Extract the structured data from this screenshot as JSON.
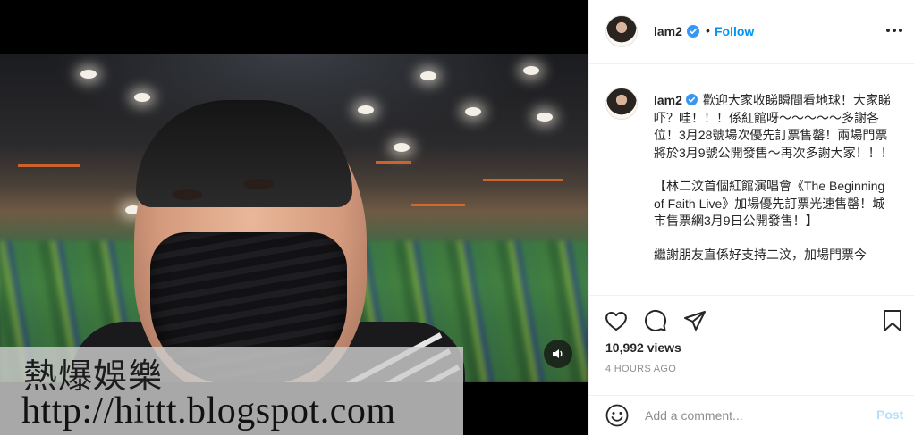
{
  "media": {
    "watermark_title": "熱爆娛樂",
    "watermark_url": "http://hittt.blogspot.com",
    "mute_icon": "speaker-icon"
  },
  "header": {
    "username": "lam2",
    "separator": "•",
    "follow_label": "Follow",
    "more_icon": "more-options-icon"
  },
  "caption": {
    "username": "lam2",
    "paragraphs": [
      "歡迎大家收睇瞬間看地球！大家睇吓？哇！！！係紅館呀～～～～～多謝各位！3月28號場次優先訂票售罄！兩場門票將於3月9號公開發售～再次多謝大家！！！",
      "【林二汶首個紅館演唱會《The Beginning of Faith Live》加場優先訂票光速售罄！城市售票網3月9日公開發售！】",
      "繼謝朋友直係好支持二汶，加場門票今"
    ]
  },
  "actions": {
    "views": "10,992 views",
    "time_ago": "4 HOURS AGO",
    "comment_placeholder": "Add a comment...",
    "post_label": "Post"
  },
  "colors": {
    "accent": "#0095f6",
    "post_disabled": "#b2dffc",
    "muted_text": "#8e8e8e",
    "primary_text": "#262626",
    "divider": "#efefef"
  }
}
